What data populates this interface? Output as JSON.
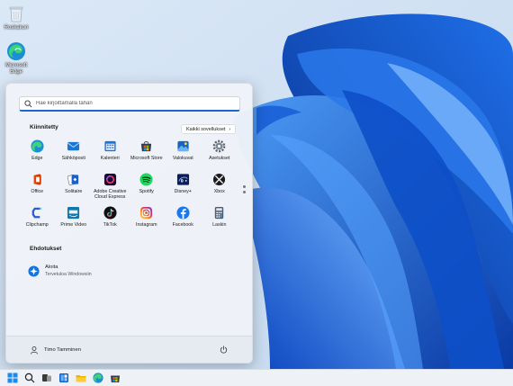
{
  "desktop": {
    "icons": [
      {
        "name": "recycle-bin-icon",
        "label": "Roskakori"
      },
      {
        "name": "edge-icon",
        "label": "Microsoft Edge"
      }
    ]
  },
  "start_menu": {
    "search_placeholder": "Hae kirjoittamalla tähän",
    "pinned_title": "Kiinnitetty",
    "all_apps_label": "Kaikki sovellukset",
    "all_apps_chevron": "›",
    "pinned": [
      {
        "label": "Edge",
        "icon": "edge-icon"
      },
      {
        "label": "Sähköposti",
        "icon": "mail-icon"
      },
      {
        "label": "Kalenteri",
        "icon": "calendar-icon"
      },
      {
        "label": "Microsoft Store",
        "icon": "store-icon"
      },
      {
        "label": "Valokuvat",
        "icon": "photos-icon"
      },
      {
        "label": "Asetukset",
        "icon": "gear-icon"
      },
      {
        "label": "Office",
        "icon": "office-icon"
      },
      {
        "label": "Solitaire",
        "icon": "solitaire-icon"
      },
      {
        "label": "Adobe Creative Cloud Express",
        "icon": "adobe-cc-icon"
      },
      {
        "label": "Spotify",
        "icon": "spotify-icon"
      },
      {
        "label": "Disney+",
        "icon": "disney-icon"
      },
      {
        "label": "Xbox",
        "icon": "xbox-icon"
      },
      {
        "label": "Clipchamp",
        "icon": "clipchamp-icon"
      },
      {
        "label": "Prime Video",
        "icon": "prime-video-icon"
      },
      {
        "label": "TikTok",
        "icon": "tiktok-icon"
      },
      {
        "label": "Instagram",
        "icon": "instagram-icon"
      },
      {
        "label": "Facebook",
        "icon": "facebook-icon"
      },
      {
        "label": "Laskin",
        "icon": "calculator-icon"
      }
    ],
    "suggestions_title": "Ehdotukset",
    "suggestion": {
      "title": "Aloita",
      "subtitle": "Tervetuloa Windowsiin",
      "icon": "get-started-icon"
    },
    "user_name": "Timo Tamminen"
  },
  "taskbar": {
    "items": [
      "start-button",
      "search-button",
      "task-view-button",
      "widgets-button",
      "file-explorer-button",
      "edge-button",
      "store-button"
    ]
  },
  "colors": {
    "accent": "#1a66d2",
    "wallpaper_base": "#cfe0f2",
    "bloom_dark": "#0b3ea8",
    "bloom_light": "#3f8ff0"
  }
}
